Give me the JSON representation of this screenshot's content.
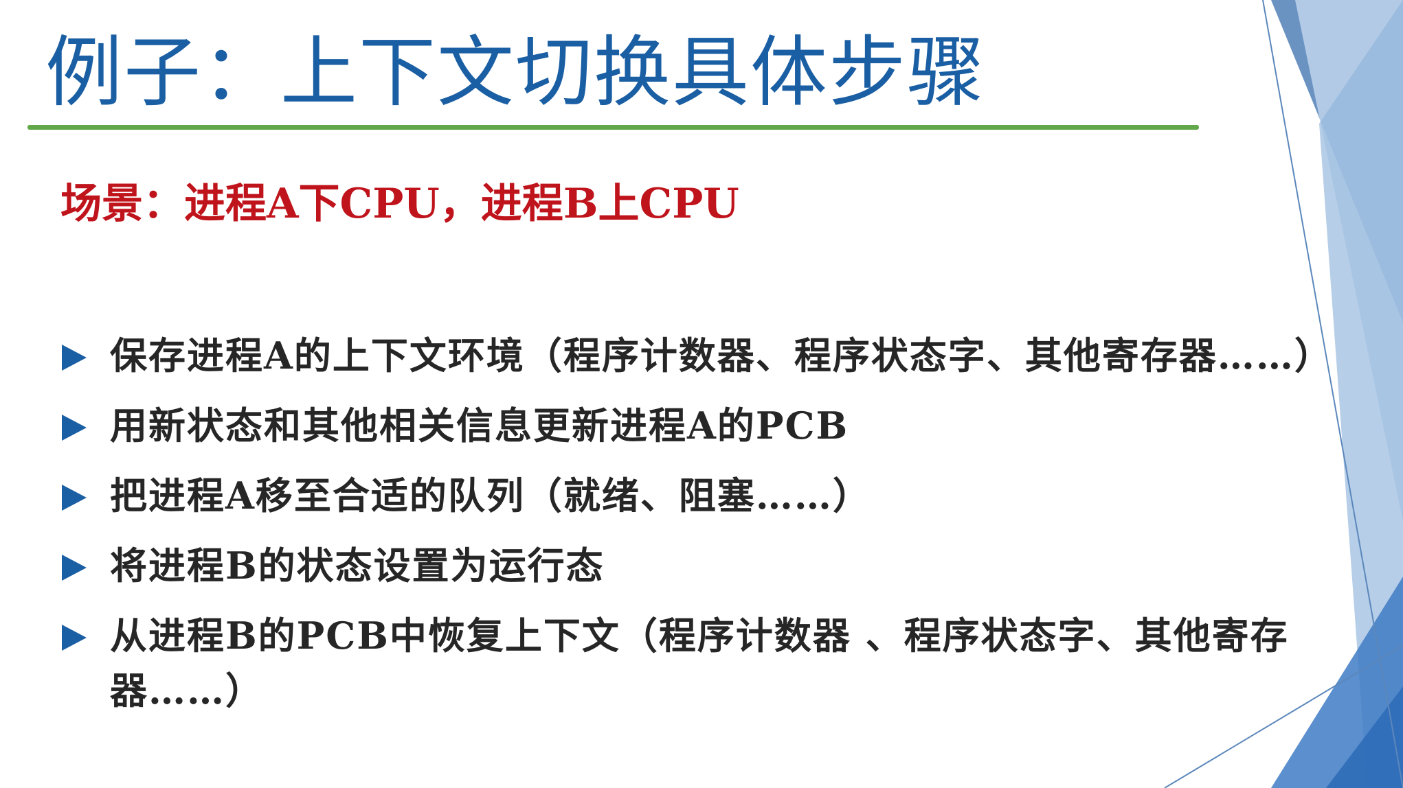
{
  "slide": {
    "title": "例子：上下文切换具体步骤",
    "scenario": "场景：进程A下CPU，进程B上CPU",
    "steps": [
      {
        "text": "保存进程A的上下文环境（程序计数器、程序状态字、其他寄存器……）"
      },
      {
        "text": "用新状态和其他相关信息更新进程A的PCB"
      },
      {
        "text": "把进程A移至合适的队列（就绪、阻塞……）"
      },
      {
        "text": "将进程B的状态设置为运行态"
      },
      {
        "text": "从进程B的PCB中恢复上下文（程序计数器 、程序状态字、其他寄存器……）"
      }
    ]
  },
  "colors": {
    "title": "#1a5ea3",
    "title_rule": "#62a84a",
    "scenario": "#c0141c",
    "bullet": "#1a5ea3",
    "body_text": "#262626",
    "decor_dark": "#5b87bb",
    "decor_mid": "#8fb3dc",
    "decor_light": "#c9dcf0"
  },
  "icons": {
    "bullet": "triangle-right-icon"
  }
}
